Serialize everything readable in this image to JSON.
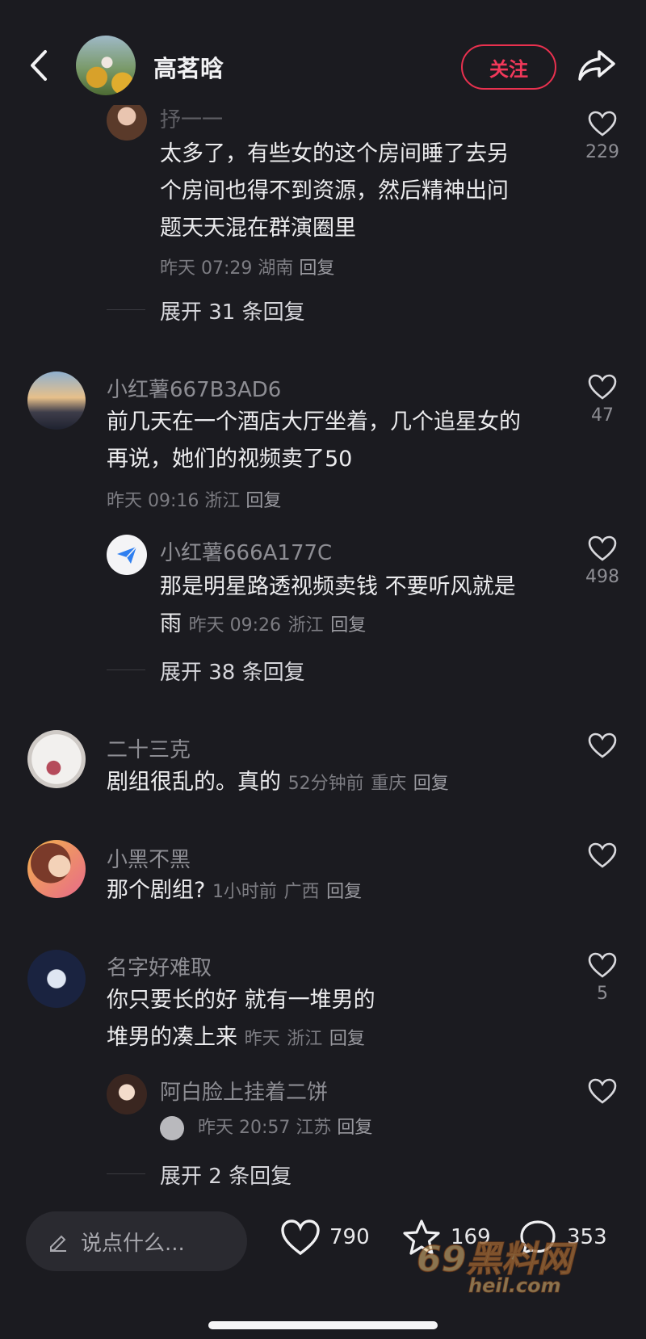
{
  "header": {
    "title": "高茗晗",
    "follow_label": "关注"
  },
  "comments": [
    {
      "username": "抒一一",
      "content_lines": [
        "太多了，有些女的这个房间睡了去另",
        "个房间也得不到资源，然后精神出问",
        "题天天混在群演圈里"
      ],
      "time": "昨天 07:29",
      "location": "湖南",
      "reply_label": "回复",
      "likes": "229",
      "expand": "展开 31 条回复"
    },
    {
      "username": "小红薯667B3AD6",
      "content_lines": [
        "前几天在一个酒店大厅坐着，几个追星女的",
        "再说，她们的视频卖了50"
      ],
      "time": "昨天 09:16",
      "location": "浙江",
      "reply_label": "回复",
      "likes": "47",
      "reply": {
        "username": "小红薯666A177C",
        "content_lines": [
          "那是明星路透视频卖钱 不要听风就是",
          "雨"
        ],
        "time": "昨天 09:26",
        "location": "浙江",
        "reply_label": "回复",
        "likes": "498"
      },
      "expand": "展开 38 条回复"
    },
    {
      "username": "二十三克",
      "content": "剧组很乱的。真的",
      "time": "52分钟前",
      "location": "重庆",
      "reply_label": "回复"
    },
    {
      "username": "小黑不黑",
      "content": "那个剧组?",
      "time": "1小时前",
      "location": "广西",
      "reply_label": "回复"
    },
    {
      "username": "名字好难取",
      "content_lines": [
        "你只要长的好 就有一堆男的",
        "堆男的凑上来"
      ],
      "time": "昨天",
      "location": "浙江",
      "reply_label": "回复",
      "likes": "5",
      "reply": {
        "username": "阿白脸上挂着二饼",
        "time": "昨天 20:57",
        "location": "江苏",
        "reply_label": "回复"
      },
      "expand": "展开 2 条回复"
    }
  ],
  "bottom_bar": {
    "input_placeholder": "说点什么...",
    "like_count": "790",
    "collect_count": "169",
    "comment_count": "353"
  },
  "watermark": {
    "text": "69黑料网",
    "subtext": "heil.com"
  },
  "colors": {
    "background": "#1b1b20",
    "accent": "#e9314f",
    "muted_text": "#8d8d93"
  },
  "icons": [
    "back-icon",
    "share-icon",
    "heart-icon",
    "pencil-icon",
    "star-icon",
    "comment-bubble-icon",
    "paper-plane-icon"
  ]
}
